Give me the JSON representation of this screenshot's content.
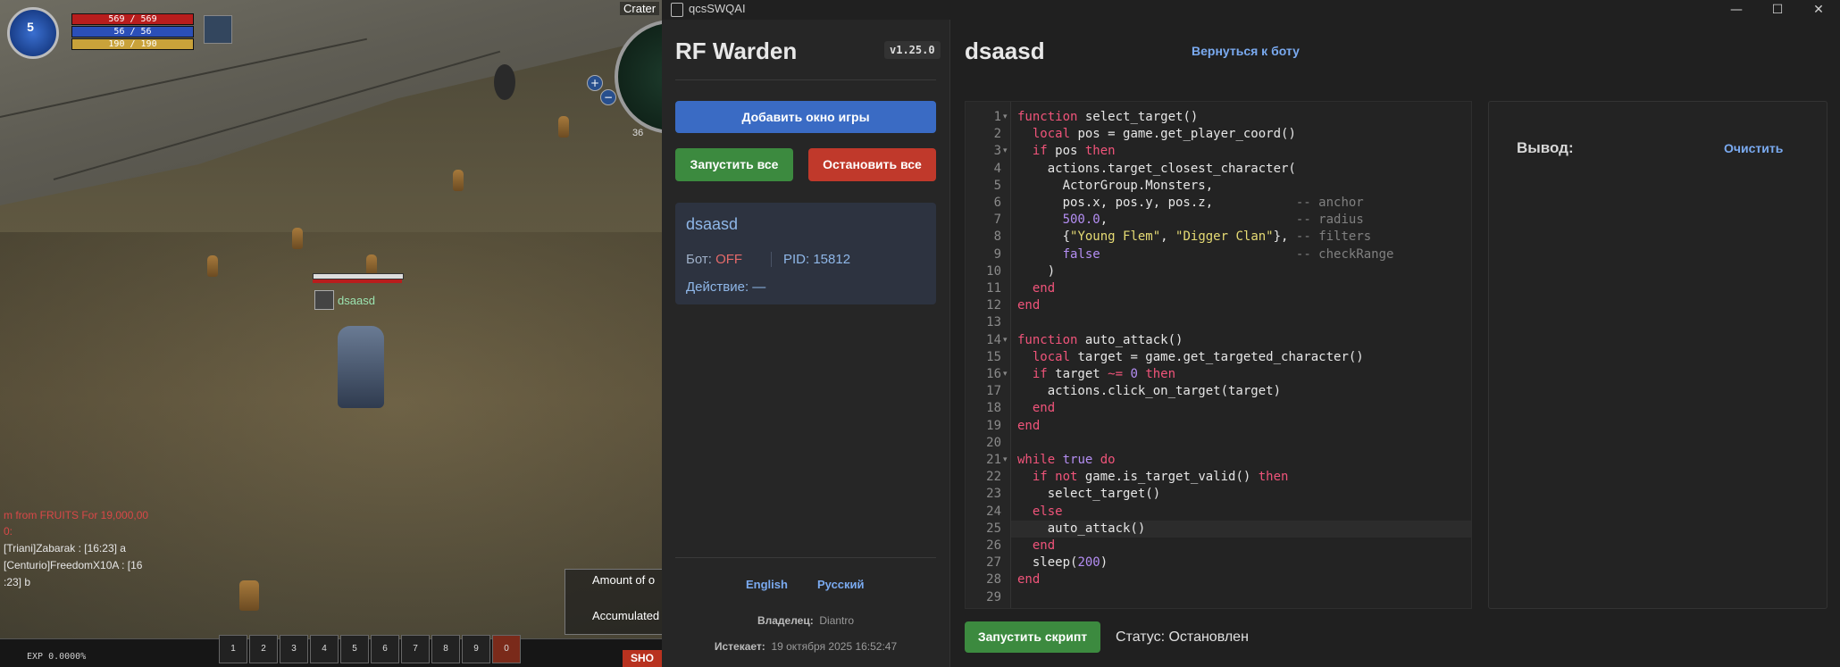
{
  "game": {
    "level": "5",
    "hp": "569 / 569",
    "fp": "56 / 56",
    "sp": "190 / 190",
    "minimap_label": "Crater",
    "minimap_num": "36",
    "player_name": "dsaasd",
    "chat": [
      {
        "text": "m from FRUITS For 19,000,00",
        "color": "#d94848"
      },
      {
        "text": "0:",
        "color": "#d94848"
      },
      {
        "text": "[Triani]Zabarak : [16:23] a",
        "color": "#e6e6e6"
      },
      {
        "text": "[Centurio]FreedomX10A : [16",
        "color": "#e6e6e6"
      },
      {
        "text": ":23] b",
        "color": "#e6e6e6"
      }
    ],
    "quest_1": "Amount of o",
    "quest_2": "Accumulated",
    "exp": "EXP 0.0000%",
    "hotbar": [
      "1",
      "2",
      "3",
      "4",
      "5",
      "6",
      "7",
      "8",
      "9",
      "0"
    ],
    "shop": "SHO"
  },
  "window": {
    "title": "qcsSWQAI",
    "minimize": "—",
    "maximize": "☐",
    "close": "✕"
  },
  "sidebar": {
    "brand": "RF Warden",
    "version": "v1.25.0",
    "add_game": "Добавить окно игры",
    "start_all": "Запустить все",
    "stop_all": "Остановить все",
    "client": {
      "name": "dsaasd",
      "bot_label": "Бот: ",
      "bot_value": "OFF",
      "pid": "PID: 15812",
      "action": "Действие: —"
    },
    "lang_en": "English",
    "lang_ru": "Русский",
    "owner_label": "Владелец:",
    "owner_value": "Diantro",
    "expires_label": "Истекает:",
    "expires_value": "19 октября 2025 16:52:47"
  },
  "main": {
    "title": "dsaasd",
    "back_link": "Вернуться к боту",
    "output_label": "Вывод:",
    "clear_link": "Очистить",
    "run_script": "Запустить скрипт",
    "status": "Статус: Остановлен"
  },
  "code_lines": [
    "<span class=\"kw\">function</span> select_target()",
    "  <span class=\"kw\">local</span> pos = game.get_player_coord()",
    "  <span class=\"kw\">if</span> pos <span class=\"kw\">then</span>",
    "    actions.target_closest_character(",
    "      ActorGroup.Monsters,",
    "      pos.x, pos.y, pos.z,           <span class=\"cm\">-- anchor</span>",
    "      <span class=\"num\">500.0</span>,                         <span class=\"cm\">-- radius</span>",
    "      {<span class=\"str\">\"Young Flem\"</span>, <span class=\"str\">\"Digger Clan\"</span>}, <span class=\"cm\">-- filters</span>",
    "      <span class=\"bl\">false</span>                          <span class=\"cm\">-- checkRange</span>",
    "    )",
    "  <span class=\"kw\">end</span>",
    "<span class=\"kw\">end</span>",
    "",
    "<span class=\"kw\">function</span> auto_attack()",
    "  <span class=\"kw\">local</span> target = game.get_targeted_character()",
    "  <span class=\"kw\">if</span> target <span class=\"kw\">~=</span> <span class=\"num\">0</span> <span class=\"kw\">then</span>",
    "    actions.click_on_target(target)",
    "  <span class=\"kw\">end</span>",
    "<span class=\"kw\">end</span>",
    "",
    "<span class=\"kw\">while</span> <span class=\"bl\">true</span> <span class=\"kw\">do</span>",
    "  <span class=\"kw\">if</span> <span class=\"kw\">not</span> game.is_target_valid() <span class=\"kw\">then</span>",
    "    select_target()",
    "  <span class=\"kw\">else</span>",
    "    auto_attack()",
    "  <span class=\"kw\">end</span>",
    "  sleep(<span class=\"num\">200</span>)",
    "<span class=\"kw\">end</span>",
    ""
  ],
  "fold_lines": [
    1,
    3,
    14,
    16,
    21
  ],
  "active_line": 25
}
